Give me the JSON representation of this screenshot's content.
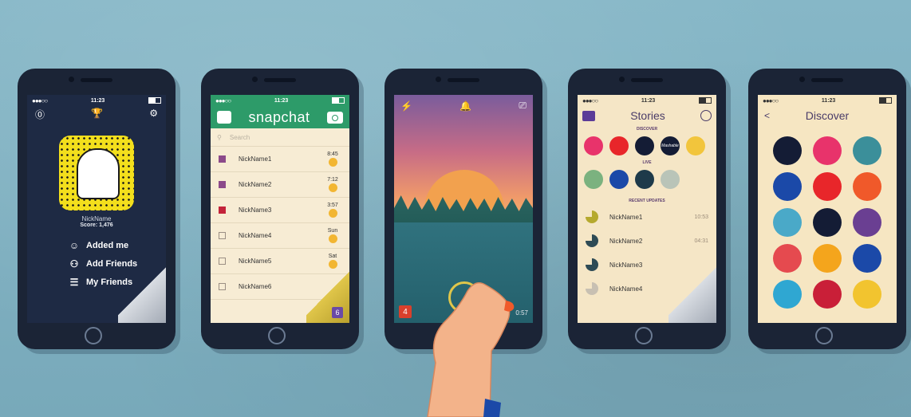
{
  "status_time": "11:23",
  "profile": {
    "name": "NickName",
    "score": "Score: 1,476",
    "menu": [
      {
        "label": "Added me"
      },
      {
        "label": "Add Friends"
      },
      {
        "label": "My Friends"
      }
    ]
  },
  "chats": {
    "title": "snapchat",
    "search_placeholder": "Search",
    "badge": "6",
    "rows": [
      {
        "name": "NickName1",
        "time": "8:45",
        "color": "#8c4a8a",
        "filled": true
      },
      {
        "name": "NickName2",
        "time": "7:12",
        "color": "#8c4a8a",
        "filled": true
      },
      {
        "name": "NickName3",
        "time": "3:57",
        "color": "#c3233a",
        "filled": true
      },
      {
        "name": "NickName4",
        "time": "Sun",
        "color": "",
        "filled": false
      },
      {
        "name": "NickName5",
        "time": "Sat",
        "color": "",
        "filled": false
      },
      {
        "name": "NickName6",
        "time": "",
        "color": "",
        "filled": false
      }
    ]
  },
  "camera": {
    "snap_count": "4",
    "timer": "0:57"
  },
  "stories": {
    "title": "Stories",
    "discover_label": "DISCOVER",
    "live_label": "LIVE",
    "recent_label": "RECENT UPDATES",
    "discover_colors": [
      "#e8336b",
      "#e8262a",
      "#141c35",
      "#141c35",
      "#f2c53c"
    ],
    "discover_logo": "Mashable",
    "live_colors": [
      "#7bb27f",
      "#1b49a8",
      "#1e3a4a",
      "#b9c4b8"
    ],
    "recent": [
      {
        "name": "NickName1",
        "time": "10:53",
        "color": "#b5a92e"
      },
      {
        "name": "NickName2",
        "time": "04:31",
        "color": "#2e4b55"
      },
      {
        "name": "NickName3",
        "time": "",
        "color": "#2e4b55"
      },
      {
        "name": "NickName4",
        "time": "",
        "color": "#c8c0b2"
      }
    ]
  },
  "discover": {
    "title": "Discover",
    "back": "<",
    "colors": [
      "#141c35",
      "#e8336b",
      "#3b8f9a",
      "#1b49a8",
      "#e8262a",
      "#f0592a",
      "#4aa9c8",
      "#141c35",
      "#6a3f92",
      "#e54a4f",
      "#f4a51c",
      "#1b49a8",
      "#2fa7d2",
      "#c91f38",
      "#f2c42f"
    ]
  },
  "icons": {
    "help": "help-icon",
    "trophy": "trophy-icon",
    "settings": "gear-icon",
    "chat": "chat-icon",
    "camera": "camera-icon",
    "flash": "flash-icon",
    "bell": "bell-icon",
    "globe": "globe-icon"
  }
}
